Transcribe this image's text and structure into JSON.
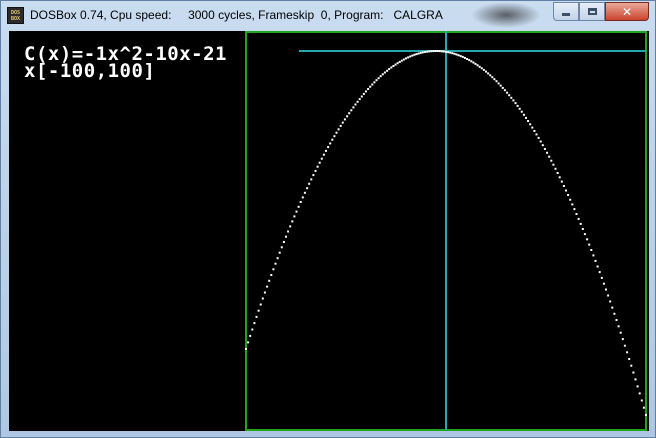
{
  "window": {
    "title": "DOSBox 0.74, Cpu speed:     3000 cycles, Frameskip  0, Program:   CALGRA",
    "icon_top": "DOS",
    "icon_bottom": "BOX",
    "minimize_icon": "minimize-icon",
    "maximize_icon": "maximize-icon",
    "close_icon": "close-icon",
    "close_glyph": "✕"
  },
  "program": {
    "formula": "C(x)=-1x^2-10x-21",
    "range": "x[-100,100]"
  },
  "colors": {
    "screen_bg": "#000000",
    "frame": "#1fa51f",
    "axes": "#27a7b0",
    "curve": "#ffffff",
    "text": "#ffffff"
  },
  "chart_data": {
    "type": "scatter",
    "function": "-1x^2-10x-21",
    "coefficients": [
      -1,
      -10,
      -21
    ],
    "xlim": [
      -100,
      100
    ],
    "x_axis": "vertical line at x = 0",
    "y_axis": "horizontal line at the curve's maximum",
    "title": "C(x)=-1x^2-10x-21"
  }
}
